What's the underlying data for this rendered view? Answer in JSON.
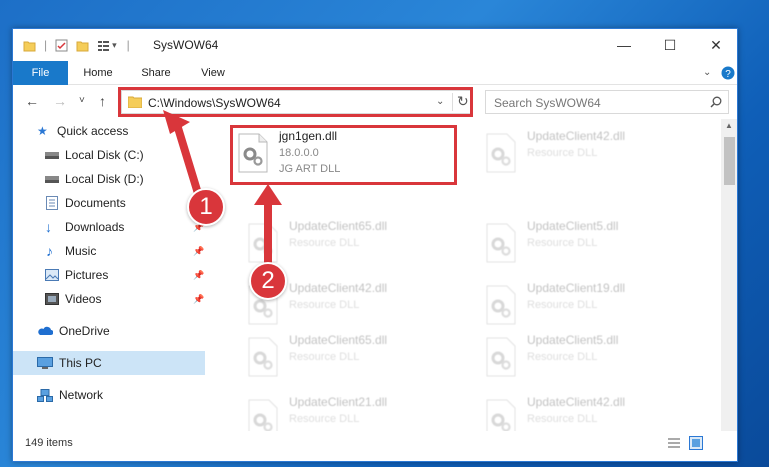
{
  "window": {
    "title": "SysWOW64",
    "controls": {
      "minimize": "—",
      "maximize": "☐",
      "close": "✕"
    }
  },
  "ribbon": {
    "tabs": [
      "File",
      "Home",
      "Share",
      "View"
    ]
  },
  "navigation": {
    "back": "←",
    "forward": "→",
    "recent": "˅",
    "up": "↑",
    "address_path": "C:\\Windows\\SysWOW64",
    "search_placeholder": "Search SysWOW64"
  },
  "sidebar": {
    "items": [
      {
        "label": "Quick access",
        "icon": "star-icon"
      },
      {
        "label": "Local Disk (C:)",
        "icon": "drive-icon"
      },
      {
        "label": "Local Disk (D:)",
        "icon": "drive-icon"
      },
      {
        "label": "Documents",
        "icon": "documents-icon"
      },
      {
        "label": "Downloads",
        "icon": "downloads-icon",
        "pinned": true
      },
      {
        "label": "Music",
        "icon": "music-icon",
        "pinned": true
      },
      {
        "label": "Pictures",
        "icon": "pictures-icon",
        "pinned": true
      },
      {
        "label": "Videos",
        "icon": "videos-icon",
        "pinned": true
      },
      {
        "label": "OneDrive",
        "icon": "onedrive-icon"
      },
      {
        "label": "This PC",
        "icon": "computer-icon",
        "selected": true
      },
      {
        "label": "Network",
        "icon": "network-icon"
      }
    ]
  },
  "files": [
    {
      "name": "jgn1gen.dll",
      "line1": "18.0.0.0",
      "line2": "JG ART DLL",
      "highlighted": true
    },
    {
      "name": "UpdateClient42.dll",
      "line1": "Resource DLL"
    },
    {
      "name": "UpdateClient65.dll",
      "line1": "Resource DLL"
    },
    {
      "name": "UpdateClient5.dll",
      "line1": "Resource DLL"
    },
    {
      "name": "UpdateClient42.dll",
      "line1": "Resource DLL"
    },
    {
      "name": "UpdateClient19.dll",
      "line1": "Resource DLL"
    },
    {
      "name": "UpdateClient65.dll",
      "line1": "Resource DLL"
    },
    {
      "name": "UpdateClient5.dll",
      "line1": "Resource DLL"
    },
    {
      "name": "UpdateClient21.dll",
      "line1": "Resource DLL"
    },
    {
      "name": "UpdateClient42.dll",
      "line1": "Resource DLL"
    }
  ],
  "status": {
    "item_count": "149 items"
  },
  "annotations": {
    "step1": "1",
    "step2": "2"
  },
  "colors": {
    "accent": "#1979ca",
    "annotation_red": "#d9363b",
    "selection": "#cce4f7"
  }
}
